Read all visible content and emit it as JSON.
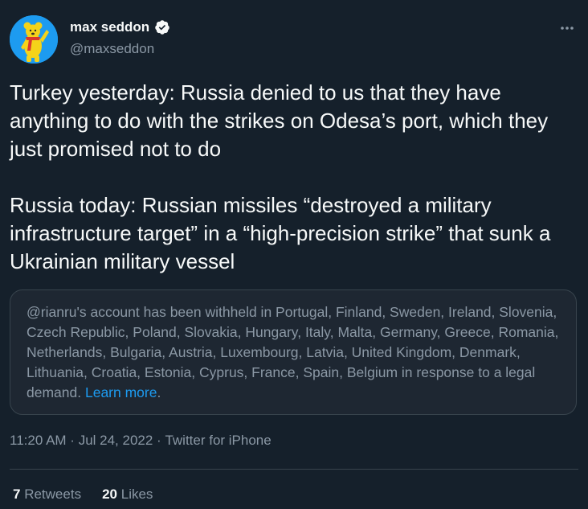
{
  "author": {
    "display_name": "max seddon",
    "handle": "@maxseddon",
    "verified": true,
    "avatar": "yellow-bear-on-blue-avatar"
  },
  "icons": {
    "verified": "verified-badge-icon",
    "more": "more-options-icon"
  },
  "tweet": {
    "paragraphs": [
      "Turkey yesterday: Russia denied to us that they have anything to do with the strikes on Odesa’s port, which they just promised not to do",
      "Russia today: Russian missiles “destroyed a military infrastructure target” in a “high-precision strike” that sunk a Ukrainian military vessel"
    ]
  },
  "withheld": {
    "text": "@rianru's account has been withheld in Portugal, Finland, Sweden, Ireland, Slovenia, Czech Republic, Poland, Slovakia, Hungary, Italy, Malta, Germany, Greece, Romania, Netherlands, Bulgaria, Austria, Luxembourg, Latvia, United Kingdom, Denmark, Lithuania, Croatia, Estonia, Cyprus, France, Spain, Belgium in response to a legal demand.",
    "learn_more": "Learn more",
    "period": "."
  },
  "meta": {
    "time": "11:20 AM",
    "separator": " · ",
    "date": "Jul 24, 2022",
    "source": "Twitter for iPhone"
  },
  "stats": {
    "retweets_count": "7",
    "retweets_label": "Retweets",
    "likes_count": "20",
    "likes_label": "Likes"
  },
  "colors": {
    "background": "#15202b",
    "text_primary": "#f7f9f9",
    "text_secondary": "#8b98a5",
    "accent": "#1d9bf0",
    "border": "#38444d",
    "avatar_yellow": "#f5d31a",
    "avatar_red": "#d9382c"
  }
}
